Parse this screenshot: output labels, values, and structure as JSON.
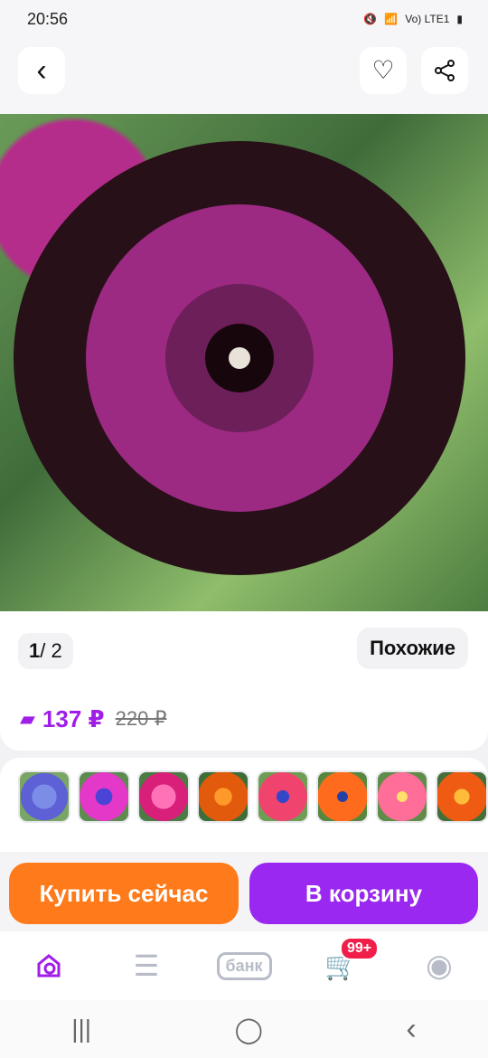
{
  "status": {
    "time": "20:56",
    "network": "Vo) LTE1"
  },
  "product": {
    "pager_current": "1",
    "pager_total": "/ 2",
    "similar_label": "Похожие",
    "price_now": "137 ₽",
    "price_old": "220 ₽"
  },
  "variants": [
    "Синий",
    "Розово-синий",
    "Малиновый",
    "Оранжевый",
    "Красно-синий",
    "Оранжево-синий",
    "Коралловый",
    "Оранжевый махровый"
  ],
  "buttons": {
    "buy_now": "Купить сейчас",
    "add_to_cart": "В корзину"
  },
  "tabbar": {
    "bank_label": "банк",
    "cart_badge": "99+"
  }
}
